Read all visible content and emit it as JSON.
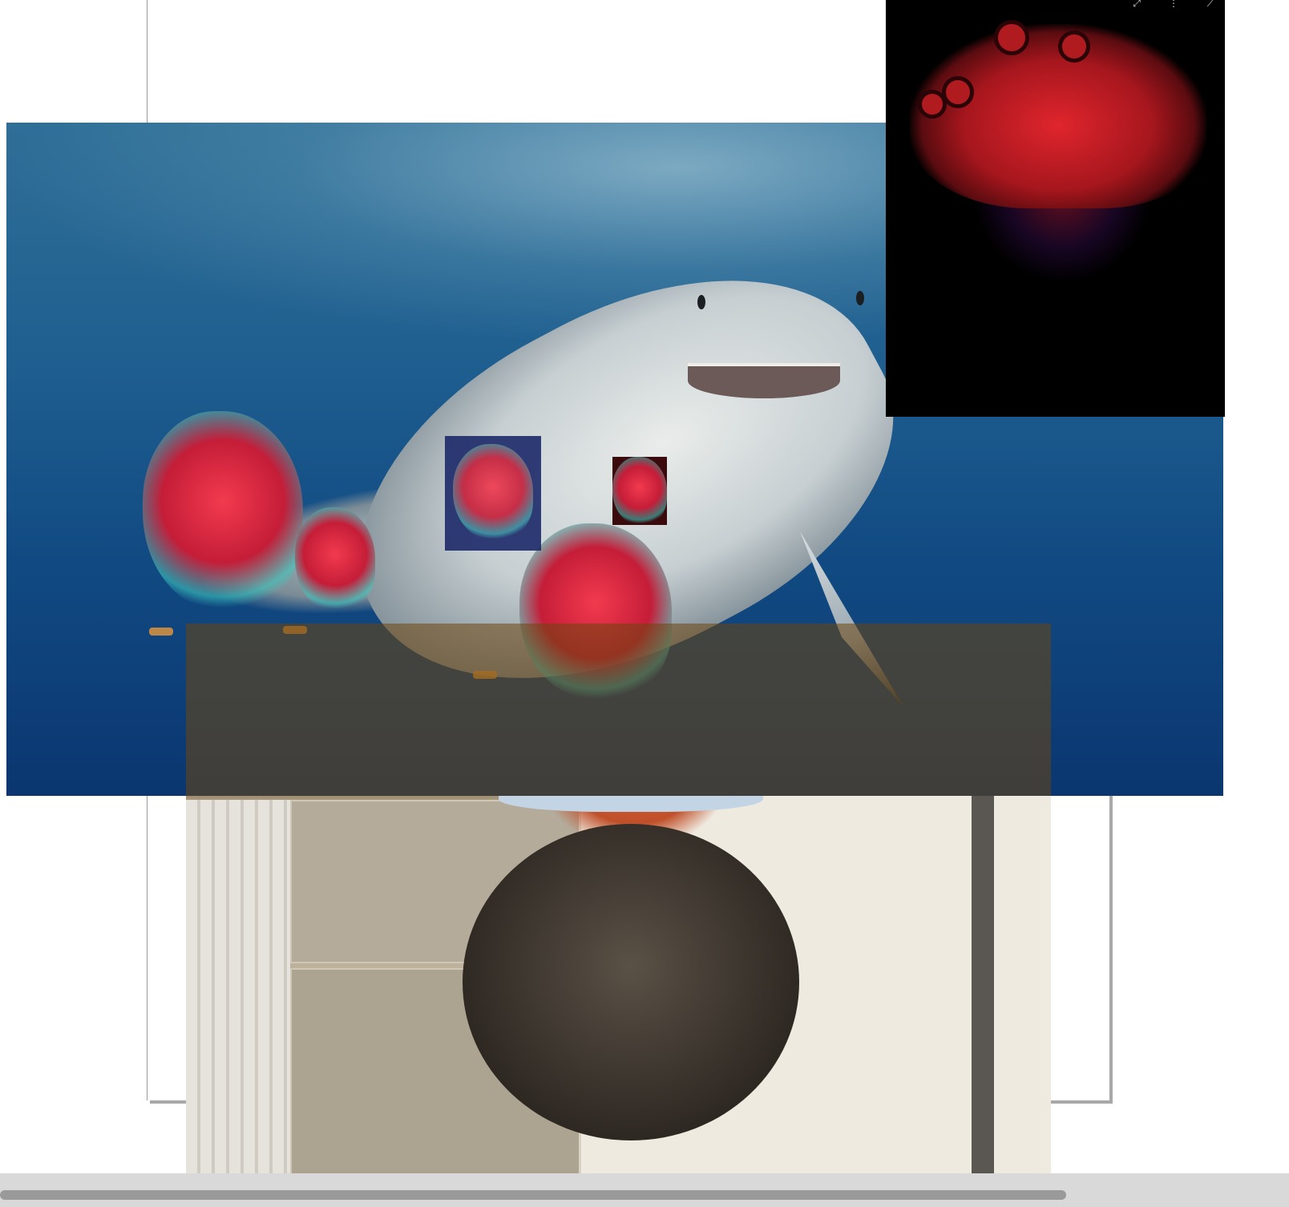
{
  "panel": {
    "expand_glyph": "⤢",
    "more_glyph": "⋮",
    "close_glyph": "⟋"
  },
  "icons": {
    "expand": "expand-icon",
    "more": "more-vert-icon",
    "close": "close-icon"
  },
  "colors": {
    "ocean": "#1f5f90",
    "heart_red": "#e0252d",
    "tint": "#6e4614",
    "scrollbar_thumb": "#9a9a9a"
  }
}
